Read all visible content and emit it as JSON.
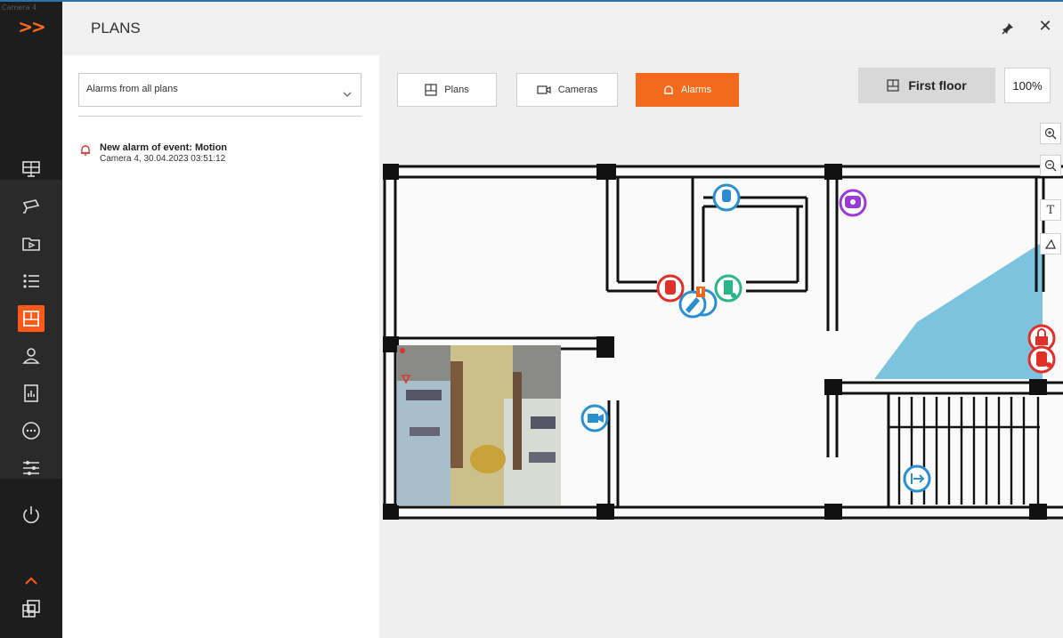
{
  "rail": {
    "expand_label": "Camera 4",
    "colors": {
      "accent": "#ff5a1a",
      "bg": "#1d1d1d"
    }
  },
  "header": {
    "title": "PLANS"
  },
  "left_panel": {
    "filter": {
      "value": "Alarms from all plans"
    },
    "alarms": [
      {
        "title": "New alarm of event: Motion",
        "subtitle": "Camera 4, 30.04.2023 03:51:12"
      }
    ]
  },
  "toolbar": {
    "plans_label": "Plans",
    "cameras_label": "Cameras",
    "alarms_label": "Alarms",
    "floor_label": "First floor",
    "zoom": "100%"
  },
  "tools": {
    "text_tool": "T"
  },
  "colors": {
    "alarm_orange": "#f46a1c",
    "camera_blue": "#2a8fd1",
    "alarm_red": "#e0302a",
    "door_green": "#2bb58a",
    "dome_purple": "#9b3bd6",
    "fov_blue": "#7cc3de"
  }
}
